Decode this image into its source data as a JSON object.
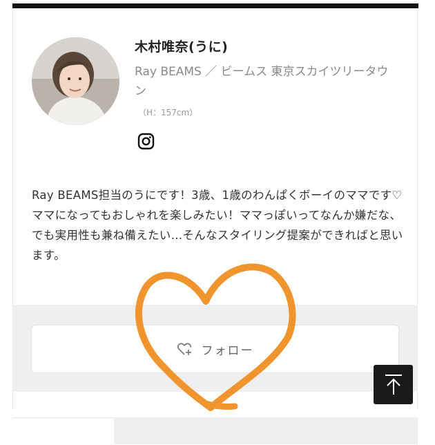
{
  "profile": {
    "name": "木村唯奈(うに)",
    "shop": "Ray BEAMS ／ ビームス 東京スカイツリータウン",
    "height": "（H：157cm）",
    "avatar_icon": "profile-photo",
    "social_icon": "instagram-icon"
  },
  "bio": "Ray BEAMS担当のうにです！3歳、1歳のわんぱくボーイのママです♡ ママになってもおしゃれを楽しみたい！ママっぽいってなんか嫌だな、でも実用性も兼ね備えたい…そんなスタイリング提案ができればと思います。",
  "actions": {
    "follow_label": "フォロー",
    "follow_icon": "heart-plus-icon",
    "back_to_top_icon": "arrow-up-icon"
  },
  "colors": {
    "annotation": "#F0952E",
    "button_dark": "#1a1a1a",
    "panel_gray": "#efefef"
  }
}
